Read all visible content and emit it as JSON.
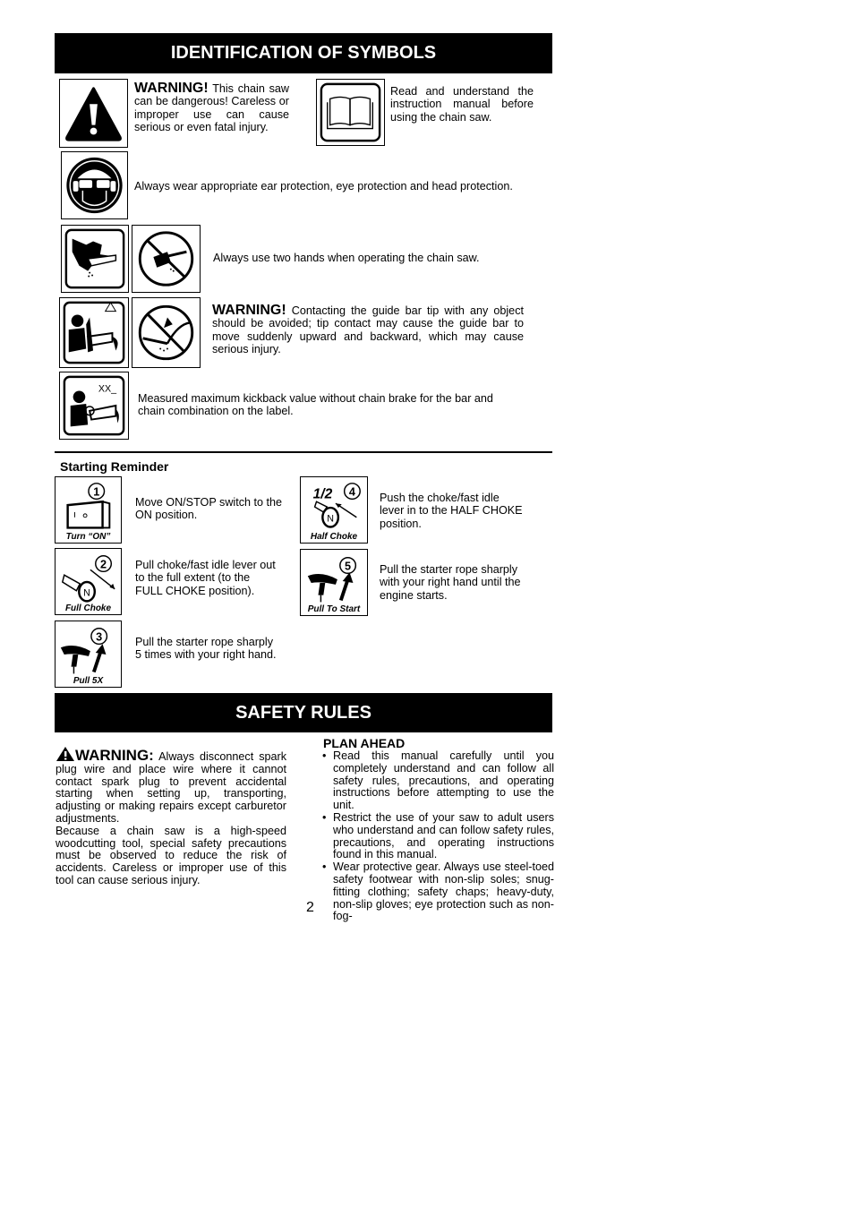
{
  "sections": {
    "symbols_title": "IDENTIFICATION OF SYMBOLS",
    "safety_title": "SAFETY RULES"
  },
  "symbols": {
    "warning": {
      "icon": "warning-triangle-icon",
      "label": "WARNING!",
      "text": "This chain saw can be dangerous! Careless or improper use can cause serious or even fatal injury."
    },
    "manual": {
      "icon": "open-book-icon",
      "text": "Read and understand the instruction manual before using the chain saw."
    },
    "protection": {
      "icon": "protective-gear-icon",
      "text": "Always wear appropriate ear protection, eye protection and head protection."
    },
    "two_hands": {
      "icons": [
        "two-hands-saw-icon",
        "one-hand-prohibited-icon"
      ],
      "text": "Always use two hands when operating the chain saw."
    },
    "kickback": {
      "icons": [
        "kickback-warning-icon",
        "tip-contact-prohibited-icon"
      ],
      "label": "WARNING!",
      "text": "Contacting the guide bar tip with any object should be avoided; tip contact may cause the guide bar to move suddenly upward and backward, which may cause serious injury."
    },
    "kickback_value": {
      "icon": "kickback-value-icon",
      "icon_label": "XX_",
      "text": "Measured maximum kickback value without chain brake for the bar and chain combination on the label."
    }
  },
  "starting_reminder": {
    "title": "Starting Reminder",
    "steps": [
      {
        "number": "1",
        "caption": "Turn “ON”",
        "icon": "on-switch-icon",
        "text": "Move ON/STOP switch to the ON position."
      },
      {
        "number": "2",
        "caption": "Full Choke",
        "icon": "full-choke-icon",
        "text": "Pull choke/fast idle lever out to the full extent (to the FULL CHOKE position)."
      },
      {
        "number": "3",
        "caption": "Pull 5X",
        "icon": "pull-handle-icon",
        "text": "Pull the starter rope sharply 5 times with your right hand."
      },
      {
        "number": "4",
        "caption": "Half Choke",
        "icon": "half-choke-icon",
        "fraction": "1/2",
        "text": "Push the choke/fast idle lever in to the HALF CHOKE position."
      },
      {
        "number": "5",
        "caption": "Pull To Start",
        "icon": "pull-handle-icon",
        "text": "Pull the starter rope sharply with your right hand until the engine starts."
      }
    ]
  },
  "safety": {
    "warning_label": "WARNING:",
    "warning_text": "Always disconnect spark plug wire and place wire where it cannot contact spark plug to prevent accidental starting when setting up, transporting, adjusting or making repairs except carburetor adjustments.",
    "paragraph": "Because a chain saw is a high-speed woodcutting tool, special safety precautions must be observed to reduce the risk of accidents. Careless or improper use of this tool can cause serious injury.",
    "plan_ahead": {
      "title": "PLAN AHEAD",
      "items": [
        "Read this manual carefully until you completely understand and can follow all safety rules, precautions, and operating instructions before attempting to use the unit.",
        "Restrict the use of your saw to adult users who understand and can follow safety rules, precautions, and operating instructions found in this manual.",
        "Wear protective gear. Always use steel-toed safety footwear with non-slip soles; snug-fitting clothing; safety chaps; heavy-duty, non-slip gloves; eye protection such as non-fog-"
      ]
    }
  },
  "page_number": "2"
}
